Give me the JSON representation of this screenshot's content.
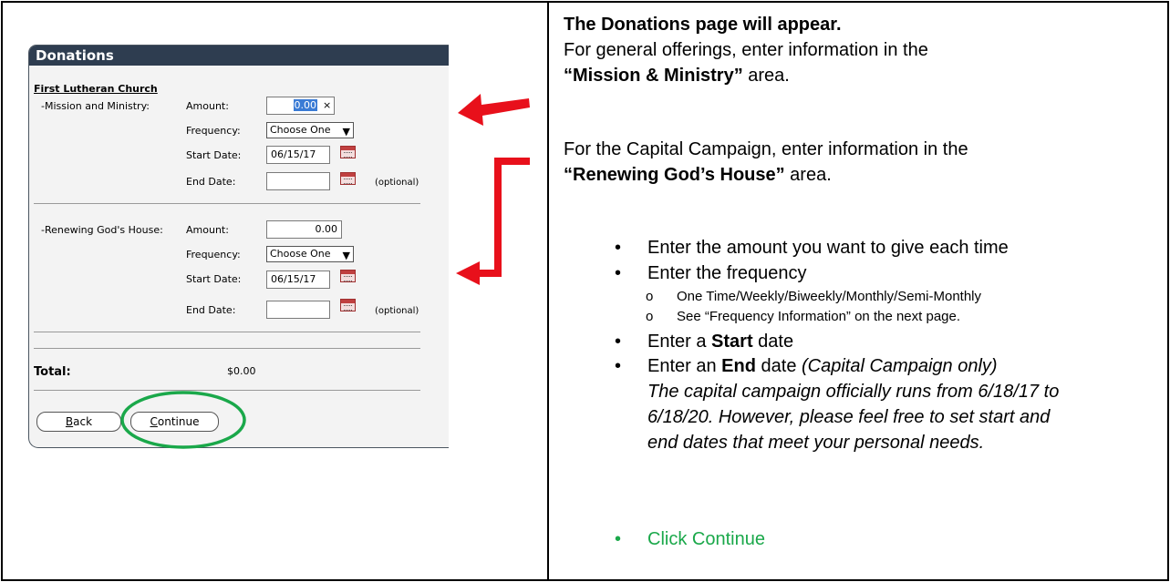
{
  "form": {
    "title": "Donations",
    "church": "First Lutheran Church",
    "groups": [
      {
        "name": "-Mission and Ministry:",
        "amount_label": "Amount:",
        "amount_value": "0.00",
        "clear": "×",
        "frequency_label": "Frequency:",
        "frequency_value": "Choose One",
        "start_label": "Start Date:",
        "start_value": "06/15/17",
        "end_label": "End Date:",
        "end_value": "",
        "optional": "(optional)"
      },
      {
        "name": "-Renewing God's House:",
        "amount_label": "Amount:",
        "amount_value": "0.00",
        "frequency_label": "Frequency:",
        "frequency_value": "Choose One",
        "start_label": "Start Date:",
        "start_value": "06/15/17",
        "end_label": "End Date:",
        "end_value": "",
        "optional": "(optional)"
      }
    ],
    "total_label": "Total:",
    "total_value": "$0.00",
    "back_label": "Back",
    "back_hotkey": "B",
    "back_rest": "ack",
    "continue_label": "Continue",
    "continue_hotkey": "C",
    "continue_rest": "ontinue"
  },
  "instructions": {
    "heading": "The Donations page will appear.",
    "line1": "For general offerings, enter information in the",
    "line2_bold": "“Mission & Ministry”",
    "line2_rest": " area.",
    "line3": "For the Capital Campaign, enter information in the",
    "line4_bold": "“Renewing God’s House”",
    "line4_rest": " area.",
    "bullet1": "Enter the amount you want to give each time",
    "bullet2": "Enter the frequency",
    "sub1": "One Time/Weekly/Biweekly/Monthly/Semi-Monthly",
    "sub2": "See “Frequency Information” on the next page.",
    "bullet3_pre": "Enter a ",
    "bullet3_bold": "Start",
    "bullet3_post": " date",
    "bullet4_pre": "Enter an ",
    "bullet4_bold": "End",
    "bullet4_post": " date ",
    "bullet4_italic": "(Capital Campaign only)",
    "note1": "The capital campaign officially runs from 6/18/17 to",
    "note2": "6/18/20.  However, please feel free to set start and",
    "note3": "end dates that meet your personal needs.",
    "bullet5": "Click Continue"
  },
  "colors": {
    "arrow": "#e8101b",
    "highlight_ellipse": "#1aa84a",
    "click_continue": "#1aa84a",
    "panel_header": "#2e3d50"
  }
}
